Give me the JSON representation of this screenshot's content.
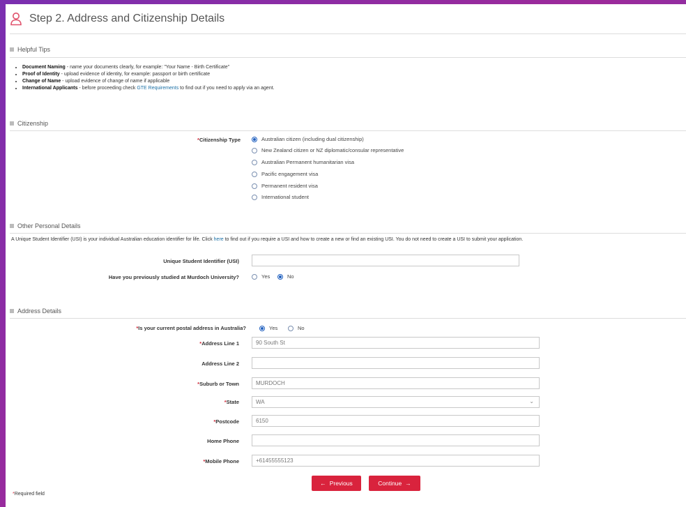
{
  "header": {
    "title": "Step 2. Address and Citizenship Details",
    "icon": "user-icon",
    "accent": "#e0516b"
  },
  "tips": {
    "heading": "Helpful Tips",
    "items": [
      {
        "bold": "Document Naming",
        "text": " - name your documents clearly, for example: \"Your Name - Birth Certificate\""
      },
      {
        "bold": "Proof of Identity",
        "text": " - upload evidence of identity, for example: passport or birth certificate"
      },
      {
        "bold": "Change of Name",
        "text": " - upload evidence of change of name if applicable"
      },
      {
        "bold": "International Applicants",
        "text": " - before proceeding check ",
        "link": "GTE Requirements",
        "tail": " to find out if you need to apply via an agent."
      }
    ]
  },
  "citizenship": {
    "heading": "Citizenship",
    "label": "Citizenship Type",
    "options": [
      "Australian citizen (including dual citizenship)",
      "New Zealand citizen or NZ diplomatic/consular representative",
      "Australian Permanent humanitarian visa",
      "Pacific engagement visa",
      "Permanent resident visa",
      "International student"
    ],
    "selected_index": 0
  },
  "personal": {
    "heading": "Other Personal Details",
    "note_pre": "A Unique Student Identifier (USI) is your individual Australian education identifier for life. Click ",
    "note_link": "here",
    "note_post": " to find out if you require a USI and how to create a new or find an existing USI. You do not need to create a USI to submit your application.",
    "usi_label": "Unique Student Identifier (USI)",
    "usi_value": "",
    "studied_label": "Have you previously studied at Murdoch University?",
    "studied_yes": "Yes",
    "studied_no": "No",
    "studied_selected": "No"
  },
  "address": {
    "heading": "Address Details",
    "in_aus_label": "Is your current postal address in Australia?",
    "in_aus_yes": "Yes",
    "in_aus_no": "No",
    "in_aus_selected": "Yes",
    "line1_label": "Address Line 1",
    "line1_value": "90 South St",
    "line2_label": "Address Line 2",
    "line2_value": "",
    "suburb_label": "Suburb or Town",
    "suburb_value": "MURDOCH",
    "state_label": "State",
    "state_value": "WA",
    "postcode_label": "Postcode",
    "postcode_value": "6150",
    "home_label": "Home Phone",
    "home_value": "",
    "mobile_label": "Mobile Phone",
    "mobile_value": "+61455555123"
  },
  "buttons": {
    "previous": "Previous",
    "continue": "Continue",
    "color": "#d9233d"
  },
  "footer": {
    "required_note": "Required field"
  }
}
